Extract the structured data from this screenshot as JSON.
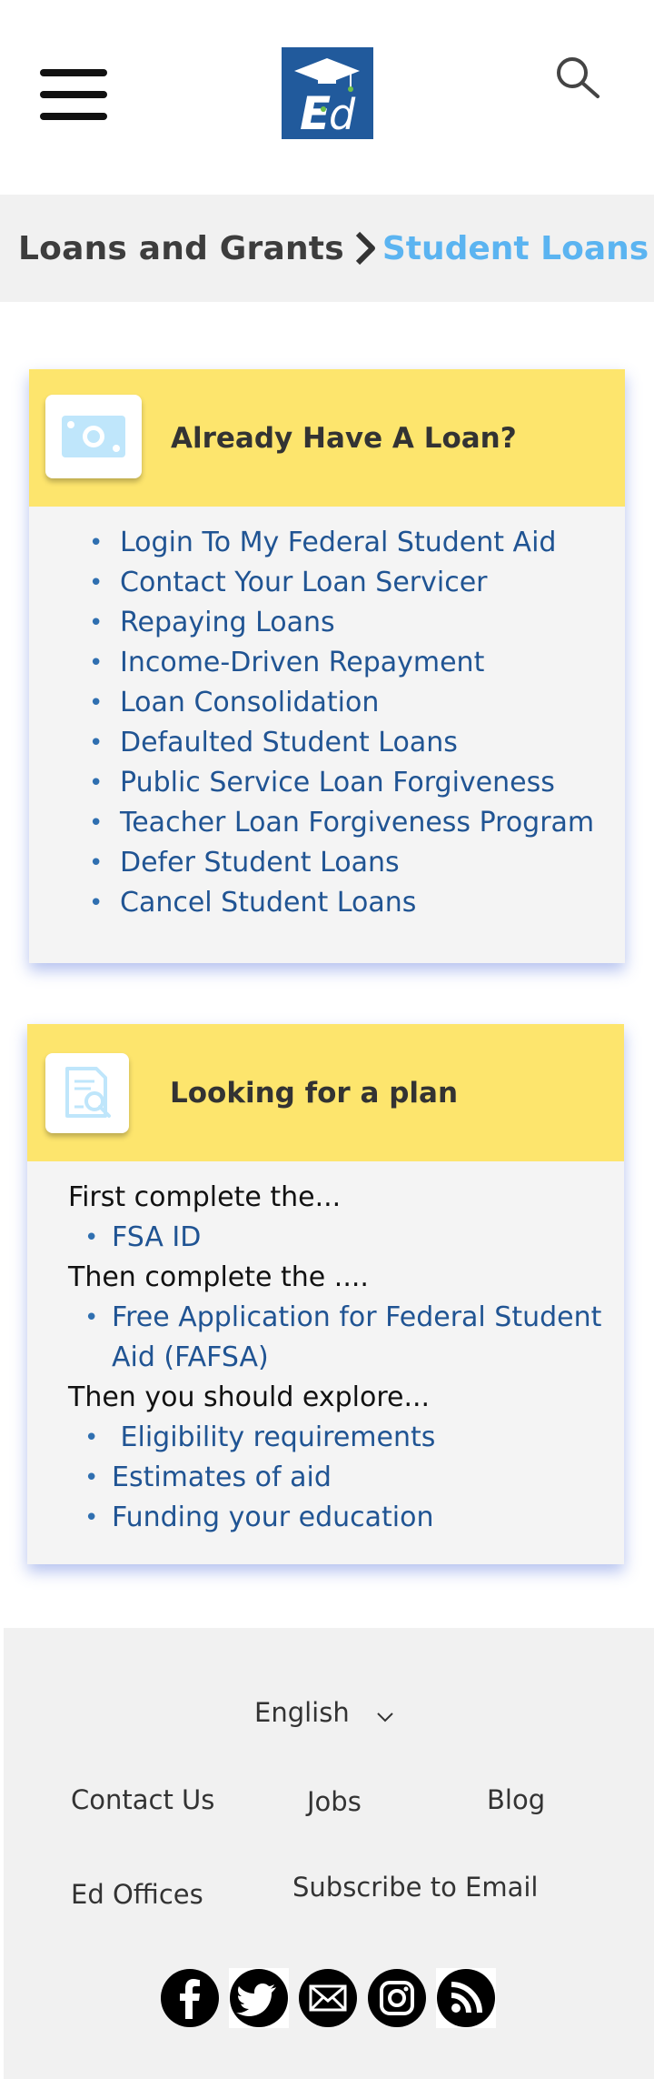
{
  "header": {
    "logo_text": "Ed",
    "logo_color": "#215a9c"
  },
  "breadcrumb": {
    "parent": "Loans and Grants",
    "current": "Student Loans",
    "current_color": "#5bb4f1"
  },
  "loan_card": {
    "title": "Already Have A Loan?",
    "icon": "money-bill-icon",
    "links": [
      "Login To My Federal Student Aid",
      "Contact Your Loan Servicer",
      "Repaying Loans",
      "Income-Driven Repayment",
      "Loan Consolidation",
      "Defaulted Student Loans",
      "Public Service Loan Forgiveness",
      "Teacher Loan Forgiveness Program",
      "Defer Student Loans",
      "Cancel Student Loans"
    ]
  },
  "plan_card": {
    "title": "Looking for a plan",
    "icon": "document-search-icon",
    "step1_text": "First complete the...",
    "step1_links": [
      "FSA ID"
    ],
    "step2_text": "Then complete the ....",
    "step2_links": [
      "Free Application for Federal Student Aid (FAFSA)"
    ],
    "step3_text": "Then you should explore...",
    "step3_links": [
      " Eligibility requirements",
      "Estimates of aid",
      "Funding your education"
    ]
  },
  "footer": {
    "language": "English",
    "links": {
      "contact": "Contact Us",
      "jobs": "Jobs",
      "blog": "Blog",
      "offices": "Ed Offices",
      "subscribe": "Subscribe to Email"
    },
    "social": [
      "facebook-icon",
      "twitter-icon",
      "email-icon",
      "instagram-icon",
      "rss-icon"
    ]
  },
  "colors": {
    "card_header": "#fde56d",
    "link": "#205493",
    "icon_light_blue": "#bfe6fb"
  }
}
